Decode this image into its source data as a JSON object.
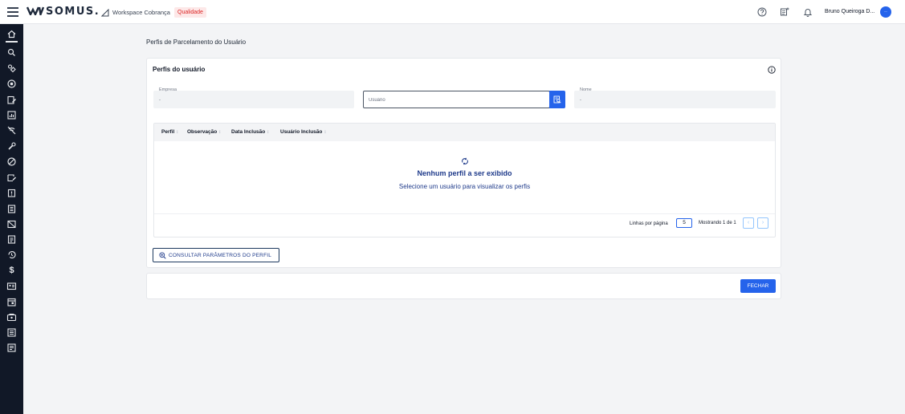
{
  "header": {
    "logo_text": "SOMUS.",
    "workspace_label": "Workspace Cobrança",
    "environment_badge": "Qualidade",
    "user_name": "Bruno Queiroga D...",
    "avatar_initials": "··",
    "icons": [
      "menu-icon",
      "help-icon",
      "release-notes-icon",
      "bell-icon"
    ]
  },
  "sidebar": {
    "items": [
      "home-icon",
      "search-icon",
      "handshake-icon",
      "target-icon",
      "edit-note-icon",
      "report-icon",
      "no-signal-icon",
      "tools-icon",
      "block-icon",
      "card-edit-icon",
      "clipboard-alert-icon",
      "document-icon",
      "no-photo-icon",
      "document-list-icon",
      "history-icon",
      "dollar-icon",
      "id-card-icon",
      "calendar-icon",
      "wallet-icon",
      "list-icon",
      "notes-icon"
    ]
  },
  "page": {
    "title": "Perfis de Parcelamento do Usuário"
  },
  "card": {
    "title": "Perfis do usuário",
    "fields": {
      "empresa": {
        "label": "Empresa",
        "value": "-"
      },
      "usuario": {
        "placeholder": "Usuário"
      },
      "nome": {
        "label": "Nome",
        "value": "-"
      }
    },
    "table": {
      "columns": [
        "Perfil",
        "Observação",
        "Data Inclusão",
        "Usuário Inclusão"
      ],
      "sort_glyph": "↕",
      "empty_title": "Nenhum perfil a ser exibido",
      "empty_subtitle": "Selecione um usuário para visualizar os perfis",
      "rows_per_page_label": "Linhas por página",
      "rows_per_page_value": "5",
      "showing_text": "Mostrando 1 de 1",
      "prev_glyph": "‹",
      "next_glyph": "›"
    },
    "consult_button": "CONSULTAR PARÂMETROS DO PERFIL"
  },
  "footer": {
    "close_button": "FECHAR"
  },
  "colors": {
    "primary": "#2563eb",
    "sidebar_bg": "#111827",
    "badge_bg": "#fde8e8",
    "badge_text": "#dc2626",
    "empty_text": "#1e3a8a"
  }
}
